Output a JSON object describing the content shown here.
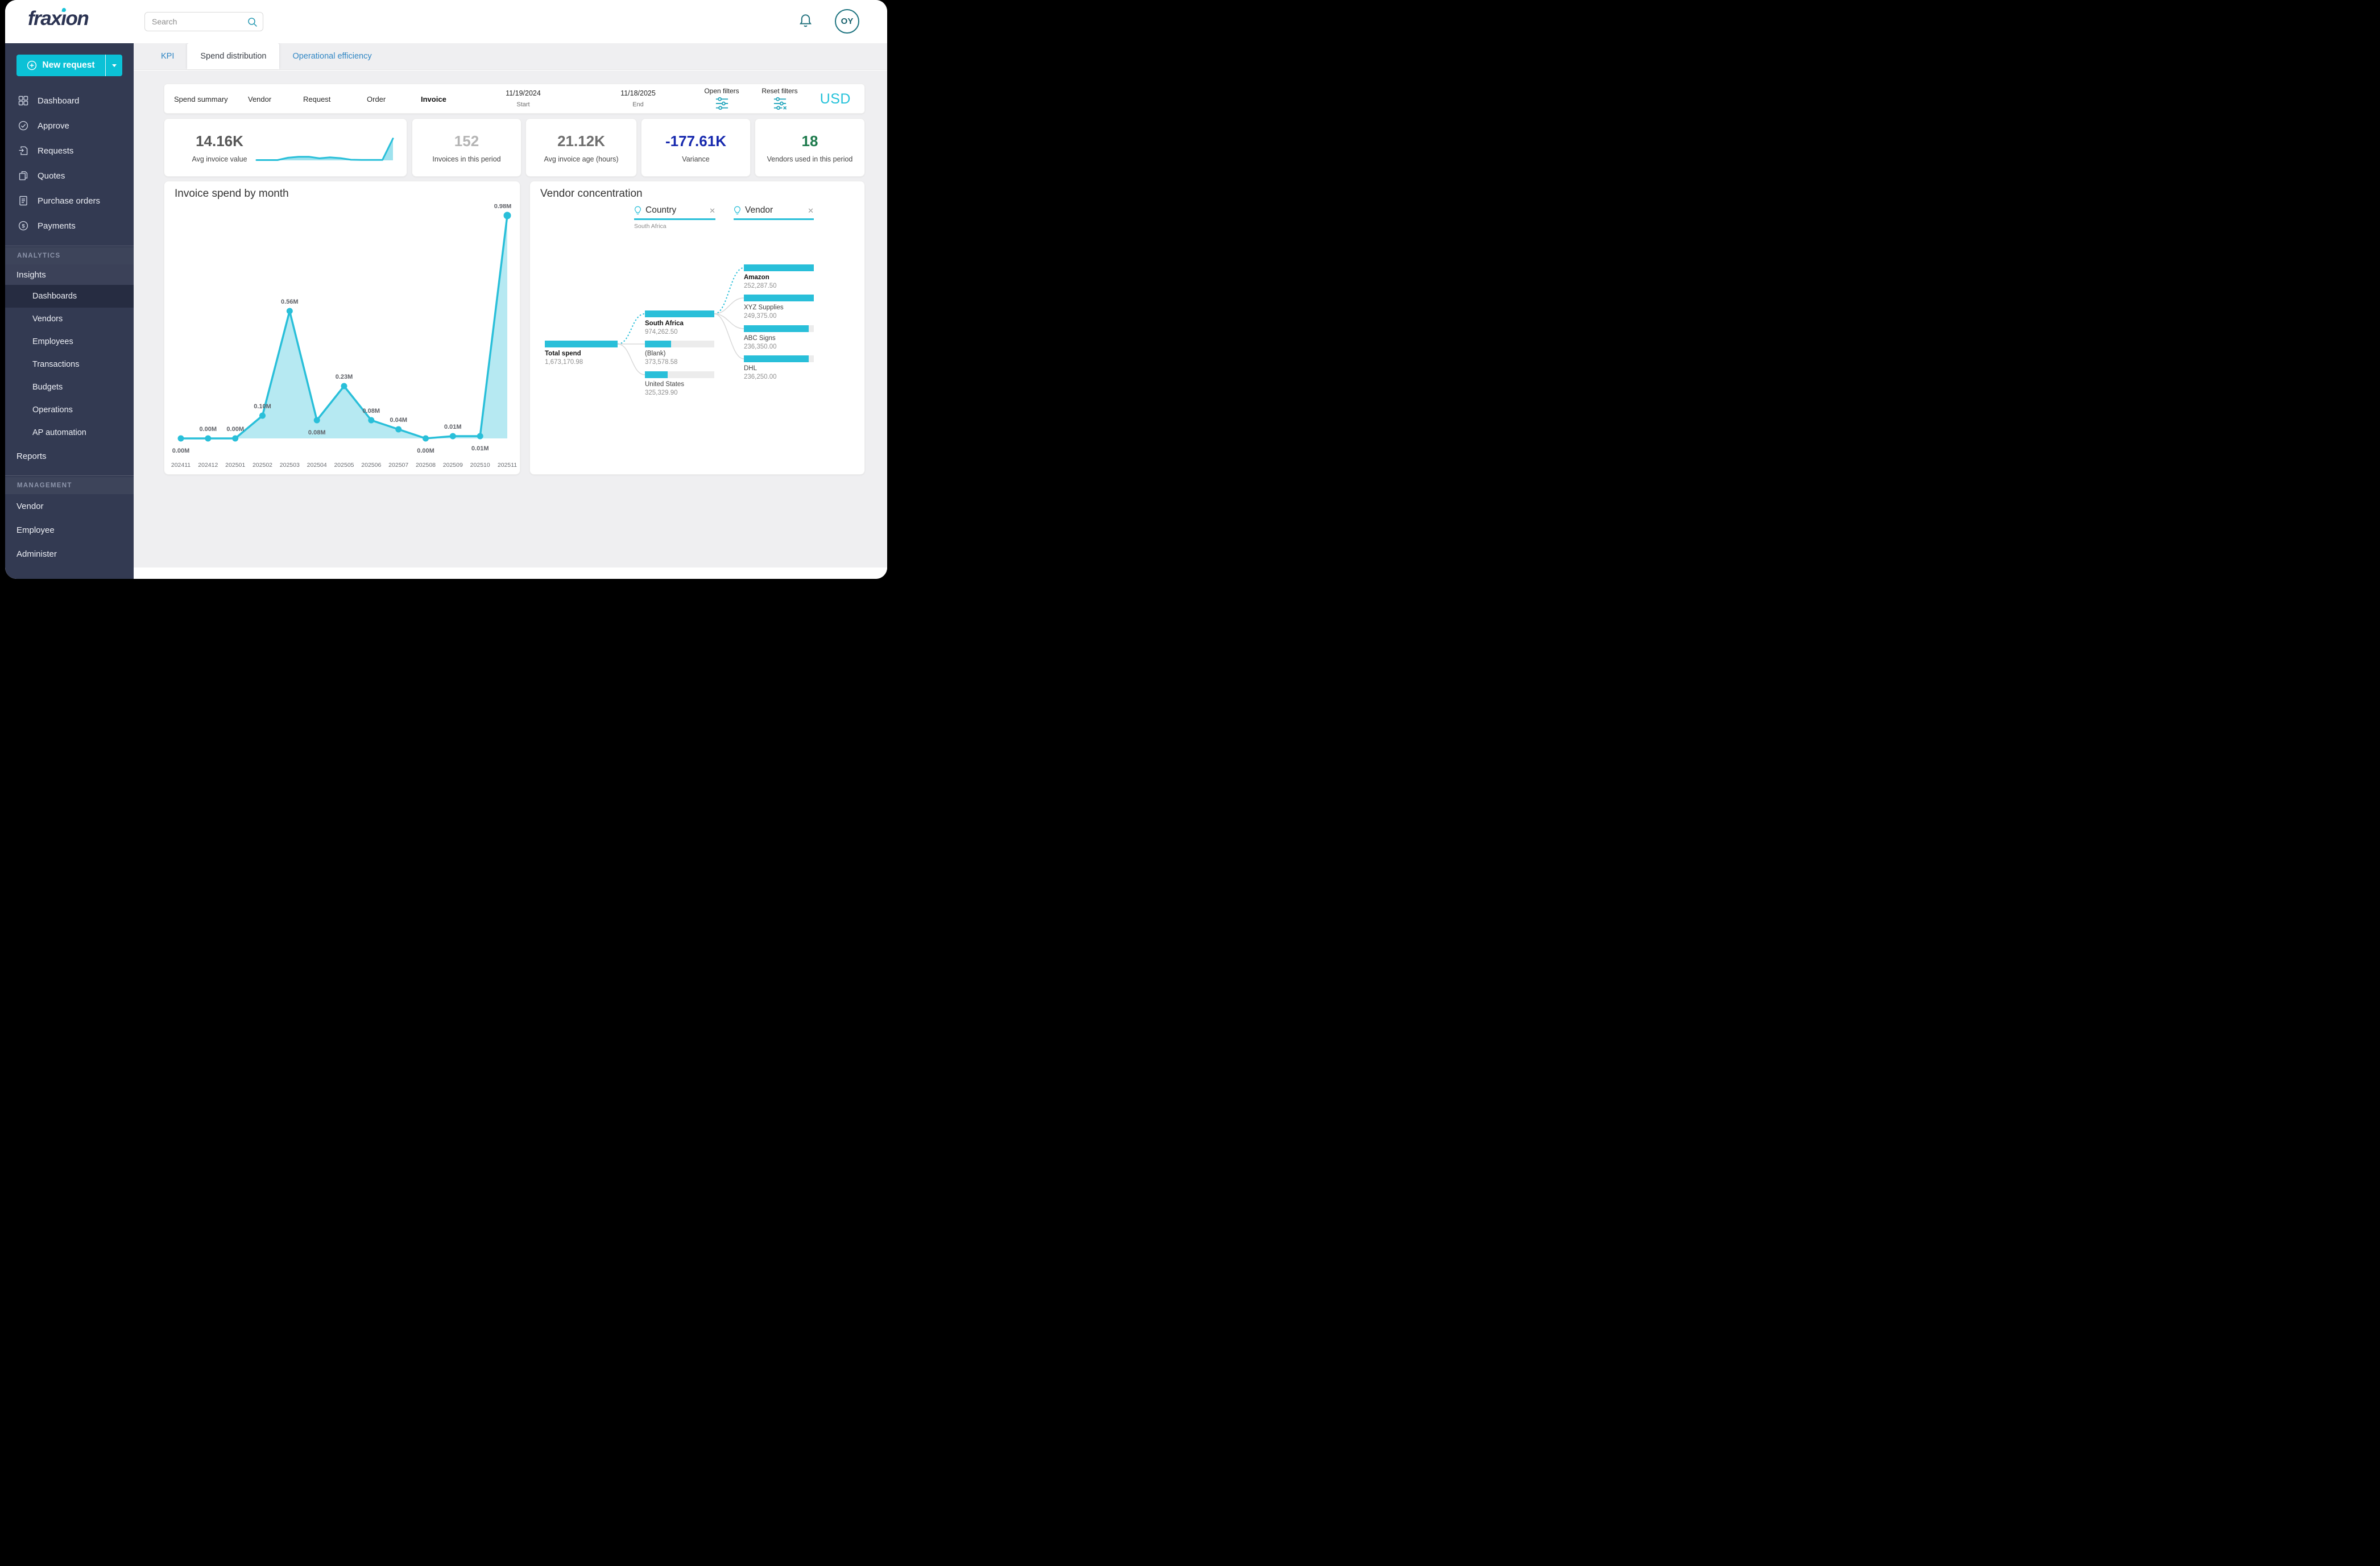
{
  "header": {
    "logo_text": "fraxion",
    "search": {
      "placeholder": "Search"
    },
    "avatar_initials": "OY"
  },
  "sidebar": {
    "new_request_label": "New request",
    "main_items": [
      {
        "label": "Dashboard",
        "icon": "dashboard-icon"
      },
      {
        "label": "Approve",
        "icon": "approve-icon"
      },
      {
        "label": "Requests",
        "icon": "requests-icon"
      },
      {
        "label": "Quotes",
        "icon": "quotes-icon"
      },
      {
        "label": "Purchase orders",
        "icon": "purchase-orders-icon"
      },
      {
        "label": "Payments",
        "icon": "payments-icon"
      }
    ],
    "analytics_section_label": "ANALYTICS",
    "insights_label": "Insights",
    "insights_items": [
      {
        "label": "Dashboards",
        "selected": true
      },
      {
        "label": "Vendors",
        "selected": false
      },
      {
        "label": "Employees",
        "selected": false
      },
      {
        "label": "Transactions",
        "selected": false
      },
      {
        "label": "Budgets",
        "selected": false
      },
      {
        "label": "Operations",
        "selected": false
      },
      {
        "label": "AP automation",
        "selected": false
      }
    ],
    "reports_label": "Reports",
    "management_section_label": "MANAGEMENT",
    "management_items": [
      {
        "label": "Vendor"
      },
      {
        "label": "Employee"
      },
      {
        "label": "Administer"
      }
    ]
  },
  "tabs": [
    {
      "label": "KPI",
      "active": false
    },
    {
      "label": "Spend distribution",
      "active": true
    },
    {
      "label": "Operational efficiency",
      "active": false
    }
  ],
  "filter_bar": {
    "views": [
      {
        "label": "Spend summary",
        "active": false
      },
      {
        "label": "Vendor",
        "active": false
      },
      {
        "label": "Request",
        "active": false
      },
      {
        "label": "Order",
        "active": false
      },
      {
        "label": "Invoice",
        "active": true
      }
    ],
    "date_start": {
      "value": "11/19/2024",
      "label": "Start"
    },
    "date_end": {
      "value": "11/18/2025",
      "label": "End"
    },
    "open_filters_label": "Open filters",
    "reset_filters_label": "Reset filters",
    "currency": "USD"
  },
  "kpi_cards": [
    {
      "value": "14.16K",
      "label": "Avg invoice value",
      "value_color": "#565656",
      "sparkline": [
        1,
        1,
        1,
        2.2,
        2.7,
        2.7,
        1.9,
        2.4,
        2.0,
        1.2,
        1.1,
        1.1,
        1.1,
        12
      ]
    },
    {
      "value": "152",
      "label": "Invoices in this period",
      "value_color": "#b4b4b4"
    },
    {
      "value": "21.12K",
      "label": "Avg invoice age (hours)",
      "value_color": "#6d6d6d"
    },
    {
      "value": "-177.61K",
      "label": "Variance",
      "value_color": "#1729ae"
    },
    {
      "value": "18",
      "label": "Vendors used in this period",
      "value_color": "#1d7a4c"
    }
  ],
  "chart_data": [
    {
      "type": "area",
      "title": "Invoice spend by month",
      "categories": [
        "202411",
        "202412",
        "202501",
        "202502",
        "202503",
        "202504",
        "202505",
        "202506",
        "202507",
        "202508",
        "202509",
        "202510",
        "202511"
      ],
      "values": [
        0.0,
        0.0,
        0.0,
        0.1,
        0.56,
        0.08,
        0.23,
        0.08,
        0.04,
        0.0,
        0.01,
        0.01,
        0.98
      ],
      "labels": [
        "0.00M",
        "0.00M",
        "0.00M",
        "0.10M",
        "0.56M",
        "0.08M",
        "0.23M",
        "0.08M",
        "0.04M",
        "0.00M",
        "0.01M",
        "0.01M",
        "0.98M"
      ],
      "label_below_indices": [
        0,
        5,
        9,
        11
      ],
      "unit": "M",
      "xlabel": "",
      "ylabel": "",
      "ylim": [
        0,
        1.03
      ],
      "grid": false,
      "legend": "none",
      "line_color": "#29bfd9",
      "area_opacity": 0.34
    },
    {
      "type": "decomposition-tree",
      "title": "Vendor concentration",
      "breadcrumbs": [
        {
          "label": "Country",
          "selected_value": "South Africa"
        },
        {
          "label": "Vendor",
          "selected_value": ""
        }
      ],
      "root": {
        "label": "Total spend",
        "display": "1,673,170.98",
        "bar_pct": 100,
        "on_path": true
      },
      "children": [
        {
          "label": "South Africa",
          "display": "974,262.50",
          "bar_pct": 100,
          "on_path": true
        },
        {
          "label": "(Blank)",
          "display": "373,578.58",
          "bar_pct": 38,
          "on_path": false
        },
        {
          "label": "United States",
          "display": "325,329.90",
          "bar_pct": 33,
          "on_path": false
        }
      ],
      "grandchildren": [
        {
          "label": "Amazon",
          "display": "252,287.50",
          "bar_pct": 100,
          "on_path": true
        },
        {
          "label": "XYZ Supplies",
          "display": "249,375.00",
          "bar_pct": 100,
          "on_path": false
        },
        {
          "label": "ABC Signs",
          "display": "236,350.00",
          "bar_pct": 93,
          "on_path": false
        },
        {
          "label": "DHL",
          "display": "236,250.00",
          "bar_pct": 93,
          "on_path": false
        }
      ],
      "bar_color": "#29bfd9"
    }
  ],
  "colors": {
    "accent_cyan": "#0bc1d6",
    "chart_cyan": "#29bfd9",
    "sidebar_bg": "#333a52",
    "sidebar_selected_bg": "#262c41",
    "content_bg": "#efeff1",
    "tab_link_blue": "#2f86c4",
    "variance_blue": "#1729ae",
    "vendors_green": "#1d7a4c"
  }
}
